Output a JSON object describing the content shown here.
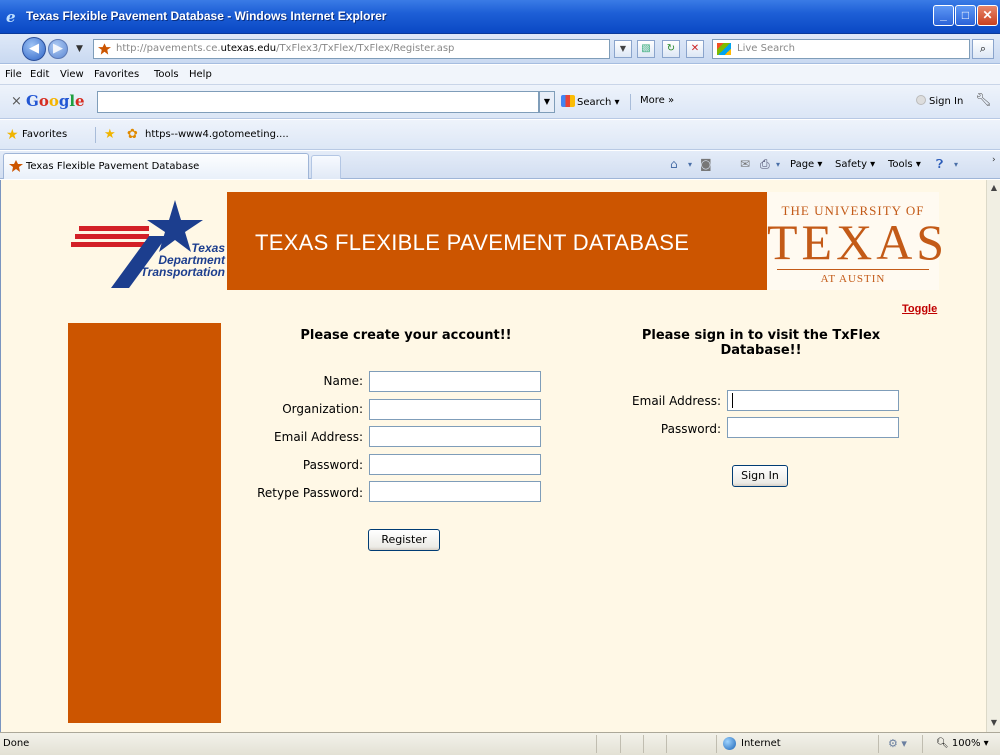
{
  "window": {
    "title": "Texas Flexible Pavement Database - Windows Internet Explorer"
  },
  "address_bar": {
    "url_prefix": "http://pavements.ce.",
    "url_domain": "utexas.edu",
    "url_path": "/TxFlex3/TxFlex/TxFlex/Register.asp",
    "live_search_placeholder": "Live Search"
  },
  "menu": {
    "items": [
      "File",
      "Edit",
      "View",
      "Favorites",
      "Tools",
      "Help"
    ]
  },
  "google_toolbar": {
    "logo": "Google",
    "close": "×",
    "search_label": "Search",
    "more_label": "More »",
    "sign_in_label": "Sign In"
  },
  "favorites_bar": {
    "favorites_label": "Favorites",
    "link_label": "https--www4.gotomeeting...."
  },
  "tabs": {
    "active_tab_label": "Texas Flexible Pavement Database",
    "command_bar": {
      "page_label": "Page",
      "safety_label": "Safety",
      "tools_label": "Tools"
    }
  },
  "page": {
    "txdot_logo": {
      "line1": "Texas",
      "line2": "Department",
      "line3": "of Transportation"
    },
    "banner_title": "TEXAS FLEXIBLE PAVEMENT DATABASE",
    "ut_logo": {
      "line1": "THE UNIVERSITY OF",
      "line2": "TEXAS",
      "line3": "AT AUSTIN"
    },
    "toggle_link": "Toggle",
    "register": {
      "heading": "Please create your account!!",
      "name_label": "Name:",
      "organization_label": "Organization:",
      "email_label": "Email Address:",
      "password_label": "Password:",
      "retype_password_label": "Retype Password:",
      "register_button": "Register"
    },
    "signin": {
      "heading_line1": "Please sign in to visit the TxFlex",
      "heading_line2": "Database!!",
      "email_label": "Email Address:",
      "password_label": "Password:",
      "signin_button": "Sign In"
    }
  },
  "status_bar": {
    "status_text": "Done",
    "zone_label": "Internet",
    "zoom_label": "100%"
  },
  "colors": {
    "burnt_orange": "#cc5500",
    "page_background": "#fff8e6",
    "txdot_blue": "#1c3e8e",
    "toggle_red": "#c00000"
  }
}
